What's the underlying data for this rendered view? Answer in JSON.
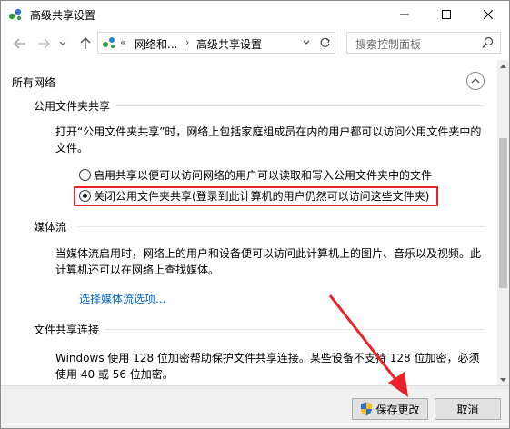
{
  "window": {
    "title": "高级共享设置"
  },
  "nav": {
    "address_chevron": "«",
    "breadcrumb": [
      "网络和...",
      "高级共享设置"
    ],
    "separator": "›",
    "search_placeholder": "搜索控制面板"
  },
  "content": {
    "section_title": "所有网络",
    "public_folder": {
      "heading": "公用文件夹共享",
      "description": "打开“公用文件夹共享”时，网络上包括家庭组成员在内的用户都可以访问公用文件夹中的文件。",
      "options": [
        {
          "label": "启用共享以便可以访问网络的用户可以读取和写入公用文件夹中的文件",
          "checked": false
        },
        {
          "label": "关闭公用文件夹共享(登录到此计算机的用户仍然可以访问这些文件夹)",
          "checked": true
        }
      ]
    },
    "media_streaming": {
      "heading": "媒体流",
      "description": "当媒体流启用时，网络上的用户和设备便可以访问此计算机上的图片、音乐以及视频。此计算机还可以在网络上查找媒体。",
      "link": "选择媒体流选项..."
    },
    "file_sharing": {
      "heading": "文件共享连接",
      "description": "Windows 使用 128 位加密帮助保护文件共享连接。某些设备不支持 128 位加密，必须使用 40 或 56 位加密。"
    }
  },
  "footer": {
    "save_label": "保存更改",
    "cancel_label": "取消"
  },
  "colors": {
    "accent_link": "#0066cc",
    "annotation_red": "#e8242b"
  }
}
